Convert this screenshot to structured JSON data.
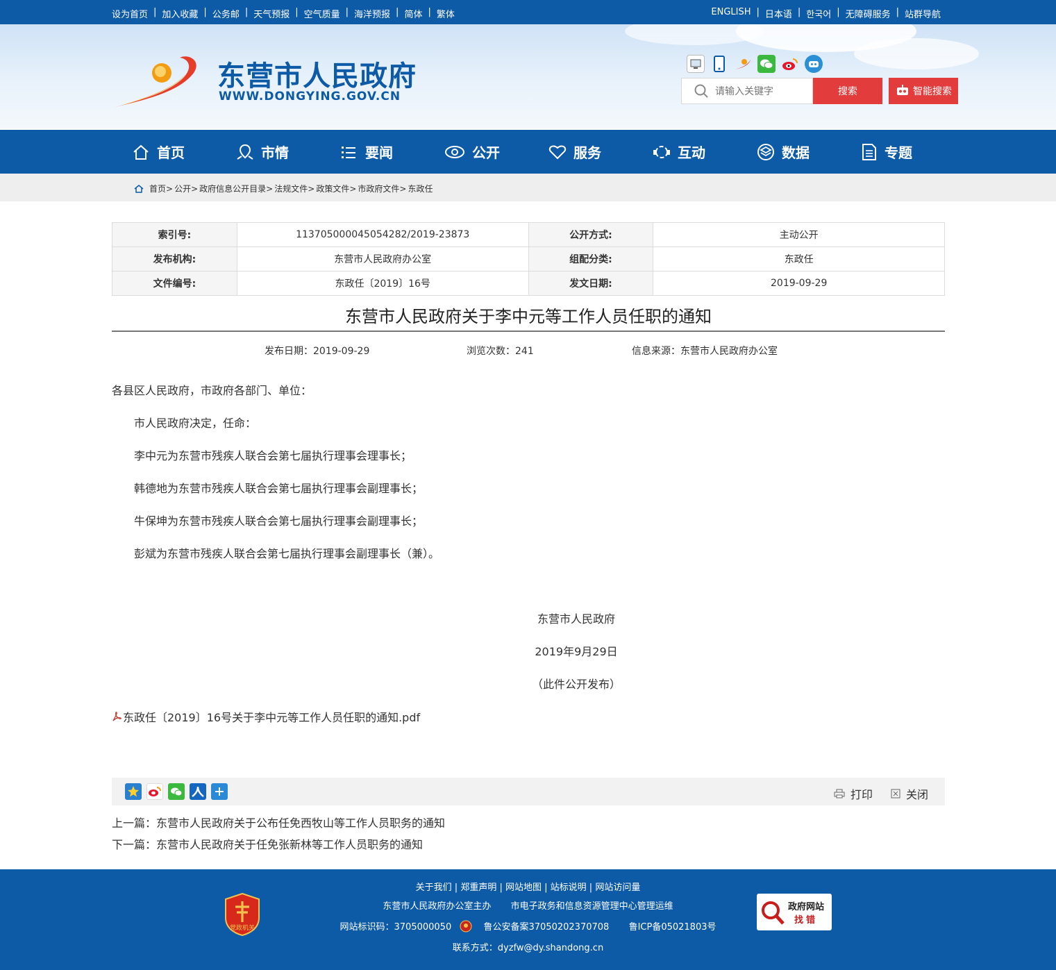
{
  "topbar": {
    "left_links": [
      "设为首页",
      "加入收藏",
      "公务邮",
      "天气预报",
      "空气质量",
      "海洋预报",
      "简体",
      "繁体"
    ],
    "right_links": [
      "ENGLISH",
      "日本语",
      "한국어",
      "无障碍服务",
      "站群导航"
    ]
  },
  "header": {
    "title": "东营市人民政府",
    "domain": "WWW.DONGYING.GOV.CN",
    "social_icons": [
      "service-hall-icon",
      "mobile-icon",
      "app-icon",
      "wechat-icon",
      "weibo-icon",
      "robot-icon"
    ],
    "search_placeholder": "请输入关键字",
    "search_button": "搜索",
    "smart_search_button": "智能搜索"
  },
  "nav": {
    "items": [
      {
        "label": "首页",
        "icon": "home-icon"
      },
      {
        "label": "市情",
        "icon": "city-icon"
      },
      {
        "label": "要闻",
        "icon": "list-icon"
      },
      {
        "label": "公开",
        "icon": "eye-icon"
      },
      {
        "label": "服务",
        "icon": "heart-icon"
      },
      {
        "label": "互动",
        "icon": "interaction-icon"
      },
      {
        "label": "数据",
        "icon": "data-icon"
      },
      {
        "label": "专题",
        "icon": "document-icon"
      }
    ]
  },
  "breadcrumb": [
    "首页",
    "公开",
    "政府信息公开目录",
    "法规文件",
    "政策文件",
    "市政府文件",
    "东政任"
  ],
  "info_table": {
    "index_label": "索引号:",
    "index_value": "113705000045054282/2019-23873",
    "open_mode_label": "公开方式:",
    "open_mode_value": "主动公开",
    "publisher_label": "发布机构:",
    "publisher_value": "东营市人民政府办公室",
    "category_label": "组配分类:",
    "category_value": "东政任",
    "doc_no_label": "文件编号:",
    "doc_no_value": "东政任〔2019〕16号",
    "issue_date_label": "发文日期:",
    "issue_date_value": "2019-09-29"
  },
  "article": {
    "title": "东营市人民政府关于李中元等工作人员任职的通知",
    "publish_date": "发布日期：2019-09-29",
    "views": "浏览次数：241",
    "source": "信息来源：东营市人民政府办公室",
    "salutation": "各县区人民政府，市政府各部门、单位：",
    "paragraphs": [
      "市人民政府决定，任命：",
      "李中元为东营市残疾人联合会第七届执行理事会理事长；",
      "韩德地为东营市残疾人联合会第七届执行理事会副理事长；",
      "牛保坤为东营市残疾人联合会第七届执行理事会副理事长；",
      "彭斌为东营市残疾人联合会第七届执行理事会副理事长（兼）。"
    ],
    "signature": "东营市人民政府",
    "sign_date": "2019年9月29日",
    "note": "（此件公开发布）",
    "attachment": "东政任〔2019〕16号关于李中元等工作人员任职的通知.pdf"
  },
  "toolbar": {
    "share_icons": [
      "qzone-icon",
      "weibo-icon",
      "wechat-icon",
      "renren-icon",
      "more-share-icon"
    ],
    "print_label": "打印",
    "close_label": "关闭"
  },
  "prev_next": {
    "prev": "上一篇：东营市人民政府关于公布任免西牧山等工作人员职务的通知",
    "next": "下一篇：东营市人民政府关于任免张新林等工作人员职务的通知"
  },
  "footer": {
    "links": [
      "关于我们",
      "郑重声明",
      "网站地图",
      "站标说明",
      "网站访问量"
    ],
    "host": "东营市人民政府办公室主办",
    "operator": "市电子政务和信息资源管理中心管理运维",
    "site_id": "网站标识码：3705000050",
    "police_record": "鲁公安备案37050202370708",
    "icp": "鲁ICP备05021803号",
    "contact": "联系方式：dyzfw@dy.shandong.cn",
    "badge_text": "党政机关",
    "error_report_line1": "政府网站",
    "error_report_line2": "找错"
  },
  "colors": {
    "primary": "#0d5aa7",
    "accent_red": "#e23c3d",
    "logo_orange": "#f39c12"
  }
}
